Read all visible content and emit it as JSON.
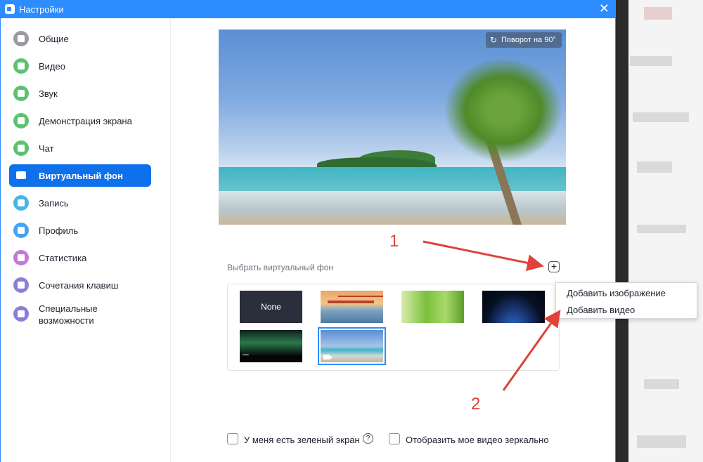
{
  "window": {
    "title": "Настройки",
    "close_glyph": "✕"
  },
  "sidebar": {
    "items": [
      {
        "label": "Общие",
        "icon": "gear-icon",
        "color": "#9a9aa5"
      },
      {
        "label": "Видео",
        "icon": "video-icon",
        "color": "#5cc26f"
      },
      {
        "label": "Звук",
        "icon": "headphones-icon",
        "color": "#5cc26f"
      },
      {
        "label": "Демонстрация экрана",
        "icon": "share-screen-icon",
        "color": "#5cc26f"
      },
      {
        "label": "Чат",
        "icon": "chat-icon",
        "color": "#5cc26f"
      },
      {
        "label": "Виртуальный фон",
        "icon": "virtual-background-icon",
        "color": "#ffffff"
      },
      {
        "label": "Запись",
        "icon": "record-icon",
        "color": "#43b6e8"
      },
      {
        "label": "Профиль",
        "icon": "profile-icon",
        "color": "#43a4f5"
      },
      {
        "label": "Статистика",
        "icon": "statistics-icon",
        "color": "#c27ad8"
      },
      {
        "label": "Сочетания клавиш",
        "icon": "keyboard-icon",
        "color": "#8a7fd8"
      },
      {
        "label": "Специальные возможности",
        "icon": "accessibility-icon",
        "color": "#8a7fd8"
      }
    ],
    "active_index": 5,
    "accent": "#0e71eb"
  },
  "preview": {
    "rotate_label": "Поворот на 90°",
    "rotate_icon": "↻"
  },
  "choose": {
    "label": "Выбрать виртуальный фон",
    "add_glyph": "+"
  },
  "gallery": {
    "items": [
      {
        "name": "none",
        "label": "None",
        "is_video": false
      },
      {
        "name": "golden-gate-bridge",
        "label": "",
        "is_video": false
      },
      {
        "name": "grass",
        "label": "",
        "is_video": false
      },
      {
        "name": "earth-from-space",
        "label": "",
        "is_video": false
      },
      {
        "name": "aurora",
        "label": "",
        "is_video": true
      },
      {
        "name": "beach-palm",
        "label": "",
        "is_video": true,
        "selected": true
      }
    ]
  },
  "menu": {
    "items": [
      "Добавить изображение",
      "Добавить видео"
    ]
  },
  "options": {
    "green_screen": "У меня есть зеленый экран",
    "mirror": "Отобразить мое видео зеркально",
    "help_glyph": "?"
  },
  "annotations": {
    "one": "1",
    "two": "2",
    "color": "#e0413a"
  }
}
